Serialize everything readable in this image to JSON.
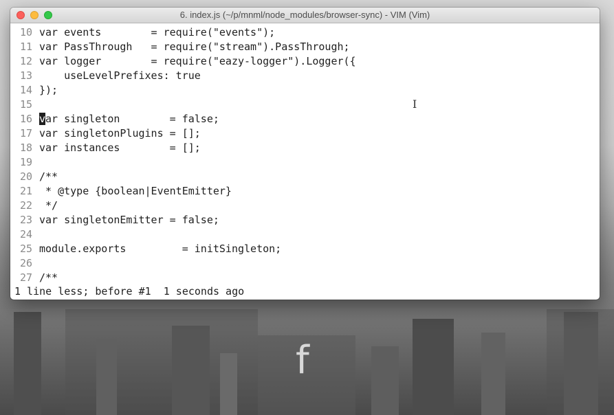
{
  "window": {
    "title": "6. index.js (~/p/mnml/node_modules/browser-sync) - VIM (Vim)"
  },
  "lines": [
    {
      "num": "10",
      "code": "var events        = require(\"events\");"
    },
    {
      "num": "11",
      "code": "var PassThrough   = require(\"stream\").PassThrough;"
    },
    {
      "num": "12",
      "code": "var logger        = require(\"eazy-logger\").Logger({"
    },
    {
      "num": "13",
      "code": "    useLevelPrefixes: true"
    },
    {
      "num": "14",
      "code": "});"
    },
    {
      "num": "15",
      "code": ""
    },
    {
      "num": "16",
      "code_cursor": "v",
      "code": "ar singleton        = false;"
    },
    {
      "num": "17",
      "code": "var singletonPlugins = [];"
    },
    {
      "num": "18",
      "code": "var instances        = [];"
    },
    {
      "num": "19",
      "code": ""
    },
    {
      "num": "20",
      "code": "/**"
    },
    {
      "num": "21",
      "code": " * @type {boolean|EventEmitter}"
    },
    {
      "num": "22",
      "code": " */"
    },
    {
      "num": "23",
      "code": "var singletonEmitter = false;"
    },
    {
      "num": "24",
      "code": ""
    },
    {
      "num": "25",
      "code": "module.exports         = initSingleton;"
    },
    {
      "num": "26",
      "code": ""
    },
    {
      "num": "27",
      "code": "/**"
    }
  ],
  "status": "1 line less; before #1  1 seconds ago",
  "desktop": {
    "app_glyph": "f"
  },
  "colors": {
    "close": "#fc605c",
    "minimize": "#fdbc40",
    "maximize": "#34c84a"
  },
  "icons": {
    "cursor": "ibeam-cursor-icon"
  }
}
